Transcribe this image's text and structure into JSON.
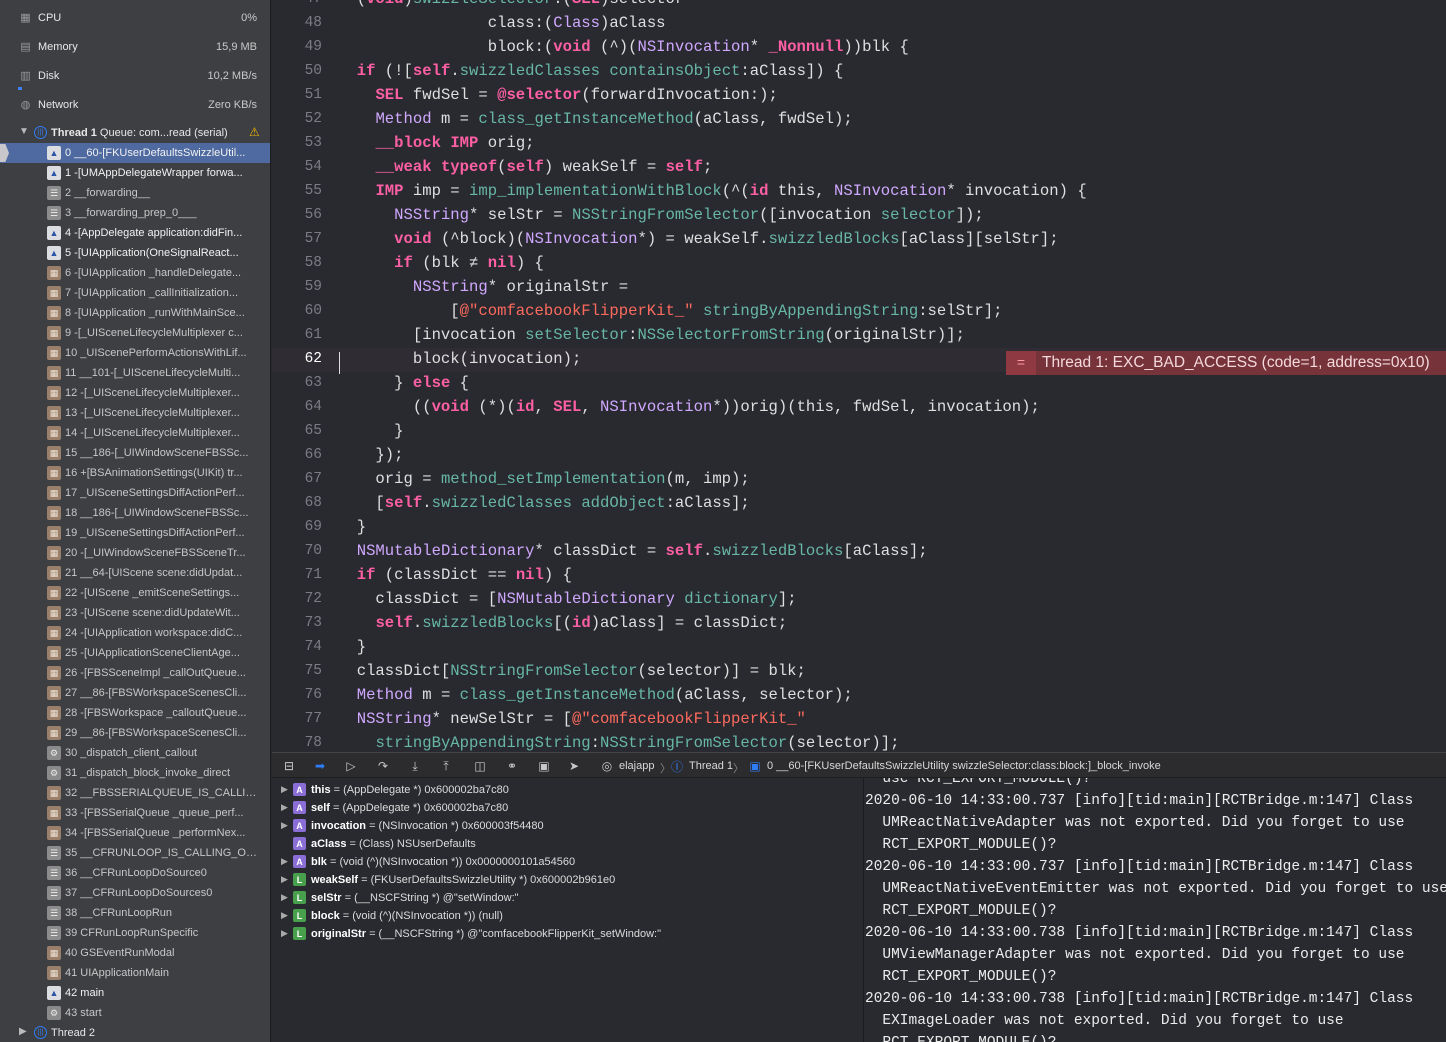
{
  "gauges": [
    {
      "label": "CPU",
      "value": "0%",
      "icon": "cpu-icon"
    },
    {
      "label": "Memory",
      "value": "15,9 MB",
      "icon": "memory-icon"
    },
    {
      "label": "Disk",
      "value": "10,2 MB/s",
      "icon": "disk-icon"
    },
    {
      "label": "Network",
      "value": "Zero KB/s",
      "icon": "network-icon"
    }
  ],
  "thread1": {
    "name": "Thread 1",
    "queue": "Queue: com...read (serial)"
  },
  "thread2": {
    "name": "Thread 2"
  },
  "frames": [
    {
      "t": "0 __60-[FKUserDefaultsSwizzleUtil...",
      "icon": "user",
      "bold": true,
      "selected": true
    },
    {
      "t": "1 -[UMAppDelegateWrapper forwa...",
      "icon": "user",
      "bold": true
    },
    {
      "t": "2 __forwarding__",
      "icon": "lib"
    },
    {
      "t": "3 __forwarding_prep_0___",
      "icon": "lib"
    },
    {
      "t": "4 -[AppDelegate application:didFin...",
      "icon": "user",
      "bold": true
    },
    {
      "t": "5 -[UIApplication(OneSignalReact...",
      "icon": "user",
      "bold": true
    },
    {
      "t": "6 -[UIApplication _handleDelegate...",
      "icon": "sys"
    },
    {
      "t": "7 -[UIApplication _callInitialization...",
      "icon": "sys"
    },
    {
      "t": "8 -[UIApplication _runWithMainSce...",
      "icon": "sys"
    },
    {
      "t": "9 -[_UISceneLifecycleMultiplexer c...",
      "icon": "sys"
    },
    {
      "t": "10 _UIScenePerformActionsWithLif...",
      "icon": "sys"
    },
    {
      "t": "11 __101-[_UISceneLifecycleMulti...",
      "icon": "sys"
    },
    {
      "t": "12 -[_UISceneLifecycleMultiplexer...",
      "icon": "sys"
    },
    {
      "t": "13 -[_UISceneLifecycleMultiplexer...",
      "icon": "sys"
    },
    {
      "t": "14 -[_UISceneLifecycleMultiplexer...",
      "icon": "sys"
    },
    {
      "t": "15 __186-[_UIWindowSceneFBSSc...",
      "icon": "sys"
    },
    {
      "t": "16 +[BSAnimationSettings(UIKit) tr...",
      "icon": "sys"
    },
    {
      "t": "17 _UISceneSettingsDiffActionPerf...",
      "icon": "sys"
    },
    {
      "t": "18 __186-[_UIWindowSceneFBSSc...",
      "icon": "sys"
    },
    {
      "t": "19 _UISceneSettingsDiffActionPerf...",
      "icon": "sys"
    },
    {
      "t": "20 -[_UIWindowSceneFBSSceneTr...",
      "icon": "sys"
    },
    {
      "t": "21 __64-[UIScene scene:didUpdat...",
      "icon": "sys"
    },
    {
      "t": "22 -[UIScene _emitSceneSettings...",
      "icon": "sys"
    },
    {
      "t": "23 -[UIScene scene:didUpdateWit...",
      "icon": "sys"
    },
    {
      "t": "24 -[UIApplication workspace:didC...",
      "icon": "sys"
    },
    {
      "t": "25 -[UIApplicationSceneClientAge...",
      "icon": "sys"
    },
    {
      "t": "26 -[FBSSceneImpl _callOutQueue...",
      "icon": "sys"
    },
    {
      "t": "27 __86-[FBSWorkspaceScenesCli...",
      "icon": "sys"
    },
    {
      "t": "28 -[FBSWorkspace _calloutQueue...",
      "icon": "sys"
    },
    {
      "t": "29 __86-[FBSWorkspaceScenesCli...",
      "icon": "sys"
    },
    {
      "t": "30 _dispatch_client_callout",
      "icon": "gear"
    },
    {
      "t": "31 _dispatch_block_invoke_direct",
      "icon": "gear"
    },
    {
      "t": "32 __FBSSERIALQUEUE_IS_CALLIN...",
      "icon": "sys"
    },
    {
      "t": "33 -[FBSSerialQueue _queue_perf...",
      "icon": "sys"
    },
    {
      "t": "34 -[FBSSerialQueue _performNex...",
      "icon": "sys"
    },
    {
      "t": "35 __CFRUNLOOP_IS_CALLING_OU...",
      "icon": "lib"
    },
    {
      "t": "36 __CFRunLoopDoSource0",
      "icon": "lib"
    },
    {
      "t": "37 __CFRunLoopDoSources0",
      "icon": "lib"
    },
    {
      "t": "38 __CFRunLoopRun",
      "icon": "lib"
    },
    {
      "t": "39 CFRunLoopRunSpecific",
      "icon": "lib"
    },
    {
      "t": "40 GSEventRunModal",
      "icon": "sys"
    },
    {
      "t": "41 UIApplicationMain",
      "icon": "sys"
    },
    {
      "t": "42 main",
      "icon": "user",
      "bold": true
    },
    {
      "t": "43 start",
      "icon": "gear"
    }
  ],
  "code_lines": [
    {
      "n": "47",
      "h": "- (<span class='k'>void</span>)<span class='m'>swizzleSelector</span>:(<span class='k'>SEL</span>)selector"
    },
    {
      "n": "48",
      "h": "                class:(<span class='t'>Class</span>)aClass"
    },
    {
      "n": "49",
      "h": "                block:(<span class='k'>void</span> (^)(<span class='t'>NSInvocation</span>* <span class='k'>_Nonnull</span>))blk {"
    },
    {
      "n": "50",
      "h": "  <span class='k'>if</span> (![<span class='k'>self</span>.<span class='m'>swizzledClasses</span> <span class='m'>containsObject</span>:aClass]) {"
    },
    {
      "n": "51",
      "h": "    <span class='k'>SEL</span> fwdSel = <span class='k'>@selector</span>(forwardInvocation:);"
    },
    {
      "n": "52",
      "h": "    <span class='t'>Method</span> m = <span class='m'>class_getInstanceMethod</span>(aClass, fwdSel);"
    },
    {
      "n": "53",
      "h": "    <span class='k'>__block</span> <span class='k'>IMP</span> orig;"
    },
    {
      "n": "54",
      "h": "    <span class='k'>__weak</span> <span class='k'>typeof</span>(<span class='k'>self</span>) weakSelf = <span class='k'>self</span>;"
    },
    {
      "n": "55",
      "h": "    <span class='k'>IMP</span> imp = <span class='m'>imp_implementationWithBlock</span>(^(<span class='k'>id</span> this, <span class='t'>NSInvocation</span>* invocation) {"
    },
    {
      "n": "56",
      "h": "      <span class='t'>NSString</span>* selStr = <span class='m'>NSStringFromSelector</span>([invocation <span class='m'>selector</span>]);"
    },
    {
      "n": "57",
      "h": "      <span class='k'>void</span> (^block)(<span class='t'>NSInvocation</span>*) = weakSelf.<span class='m'>swizzledBlocks</span>[aClass][selStr];"
    },
    {
      "n": "58",
      "h": "      <span class='k'>if</span> (blk ≠ <span class='k'>nil</span>) {"
    },
    {
      "n": "59",
      "h": "        <span class='t'>NSString</span>* originalStr ="
    },
    {
      "n": "60",
      "h": "            [<span class='s'>@\"comfacebookFlipperKit_\"</span> <span class='m'>stringByAppendingString</span>:selStr];"
    },
    {
      "n": "61",
      "h": "        [invocation <span class='m'>setSelector</span>:<span class='m'>NSSelectorFromString</span>(originalStr)];"
    },
    {
      "n": "62",
      "h": "        block(invocation);",
      "cur": true
    },
    {
      "n": "63",
      "h": "      } <span class='k'>else</span> {"
    },
    {
      "n": "64",
      "h": "        ((<span class='k'>void</span> (*)(<span class='k'>id</span>, <span class='k'>SEL</span>, <span class='t'>NSInvocation</span>*))orig)(this, fwdSel, invocation);"
    },
    {
      "n": "65",
      "h": "      }"
    },
    {
      "n": "66",
      "h": "    });"
    },
    {
      "n": "67",
      "h": "    orig = <span class='m'>method_setImplementation</span>(m, imp);"
    },
    {
      "n": "68",
      "h": "    [<span class='k'>self</span>.<span class='m'>swizzledClasses</span> <span class='m'>addObject</span>:aClass];"
    },
    {
      "n": "69",
      "h": "  }"
    },
    {
      "n": "70",
      "h": "  <span class='t'>NSMutableDictionary</span>* classDict = <span class='k'>self</span>.<span class='m'>swizzledBlocks</span>[aClass];"
    },
    {
      "n": "71",
      "h": "  <span class='k'>if</span> (classDict == <span class='k'>nil</span>) {"
    },
    {
      "n": "72",
      "h": "    classDict = [<span class='t'>NSMutableDictionary</span> <span class='m'>dictionary</span>];"
    },
    {
      "n": "73",
      "h": "    <span class='k'>self</span>.<span class='m'>swizzledBlocks</span>[(<span class='k'>id</span>)aClass] = classDict;"
    },
    {
      "n": "74",
      "h": "  }"
    },
    {
      "n": "75",
      "h": "  classDict[<span class='m'>NSStringFromSelector</span>(selector)] = blk;"
    },
    {
      "n": "76",
      "h": "  <span class='t'>Method</span> m = <span class='m'>class_getInstanceMethod</span>(aClass, selector);"
    },
    {
      "n": "77",
      "h": "  <span class='t'>NSString</span>* newSelStr = [<span class='s'>@\"comfacebookFlipperKit_\"</span>"
    },
    {
      "n": "78",
      "h": "    <span class='m'>stringByAppendingString</span>:<span class='m'>NSStringFromSelector</span>(selector)];"
    }
  ],
  "error": {
    "icon": "=",
    "text": "Thread 1: EXC_BAD_ACCESS (code=1, address=0x10)"
  },
  "debugbar": {
    "app": "elajapp",
    "thread": "Thread 1",
    "frame": "0 __60-[FKUserDefaultsSwizzleUtility swizzleSelector:class:block:]_block_invoke"
  },
  "variables": [
    {
      "kind": "A",
      "name": "this",
      "val": " = (AppDelegate *) 0x600002ba7c80",
      "exp": true
    },
    {
      "kind": "A",
      "name": "self",
      "val": " = (AppDelegate *) 0x600002ba7c80",
      "exp": true
    },
    {
      "kind": "A",
      "name": "invocation",
      "val": " = (NSInvocation *) 0x600003f54480",
      "exp": true
    },
    {
      "kind": "A",
      "name": "aClass",
      "val": " = (Class) NSUserDefaults",
      "exp": false
    },
    {
      "kind": "A",
      "name": "blk",
      "val": " = (void (^)(NSInvocation *)) 0x0000000101a54560",
      "exp": true
    },
    {
      "kind": "L",
      "name": "weakSelf",
      "val": " = (FKUserDefaultsSwizzleUtility *) 0x600002b961e0",
      "exp": true
    },
    {
      "kind": "L",
      "name": "selStr",
      "val": " = (__NSCFString *) @\"setWindow:\"",
      "exp": true
    },
    {
      "kind": "L",
      "name": "block",
      "val": " = (void (^)(NSInvocation *)) (null)",
      "exp": true
    },
    {
      "kind": "L",
      "name": "originalStr",
      "val": " = (__NSCFString *) @\"comfacebookFlipperKit_setWindow:\"",
      "exp": true
    }
  ],
  "console_lines": [
    "  use RCT_EXPORT_MODULE()?",
    "2020-06-10 14:33:00.737 [info][tid:main][RCTBridge.m:147] Class",
    "  UMReactNativeAdapter was not exported. Did you forget to use",
    "  RCT_EXPORT_MODULE()?",
    "2020-06-10 14:33:00.737 [info][tid:main][RCTBridge.m:147] Class",
    "  UMReactNativeEventEmitter was not exported. Did you forget to use",
    "  RCT_EXPORT_MODULE()?",
    "2020-06-10 14:33:00.738 [info][tid:main][RCTBridge.m:147] Class",
    "  UMViewManagerAdapter was not exported. Did you forget to use",
    "  RCT_EXPORT_MODULE()?",
    "2020-06-10 14:33:00.738 [info][tid:main][RCTBridge.m:147] Class",
    "  EXImageLoader was not exported. Did you forget to use",
    "  RCT_EXPORT_MODULE()?"
  ]
}
